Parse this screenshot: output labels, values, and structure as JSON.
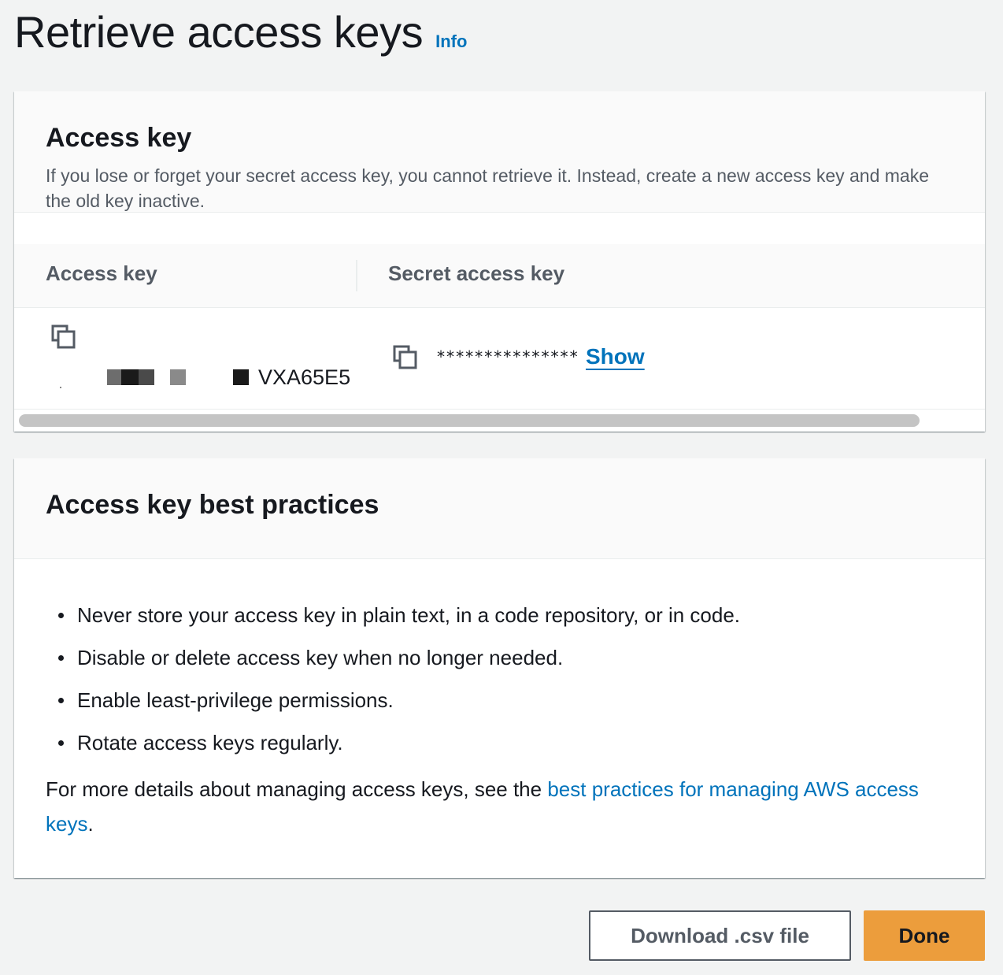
{
  "header": {
    "title": "Retrieve access keys",
    "info_label": "Info"
  },
  "access_key_panel": {
    "title": "Access key",
    "description": "If you lose or forget your secret access key, you cannot retrieve it. Instead, create a new access key and make the old key inactive.",
    "columns": [
      "Access key",
      "Secret access key"
    ],
    "row": {
      "access_key_visible_suffix": "VXA65E5",
      "secret_mask": "***************",
      "show_label": "Show"
    }
  },
  "best_practices_panel": {
    "title": "Access key best practices",
    "items": [
      "Never store your access key in plain text, in a code repository, or in code.",
      "Disable or delete access key when no longer needed.",
      "Enable least-privilege permissions.",
      "Rotate access keys regularly."
    ],
    "details_prefix": "For more details about managing access keys, see the ",
    "details_link": "best practices for managing AWS access keys",
    "details_suffix": "."
  },
  "actions": {
    "download_label": "Download .csv file",
    "done_label": "Done"
  },
  "colors": {
    "link": "#0073bb",
    "primary_button": "#ec9d3c",
    "background": "#f2f3f3"
  },
  "icons": [
    "copy-icon"
  ]
}
